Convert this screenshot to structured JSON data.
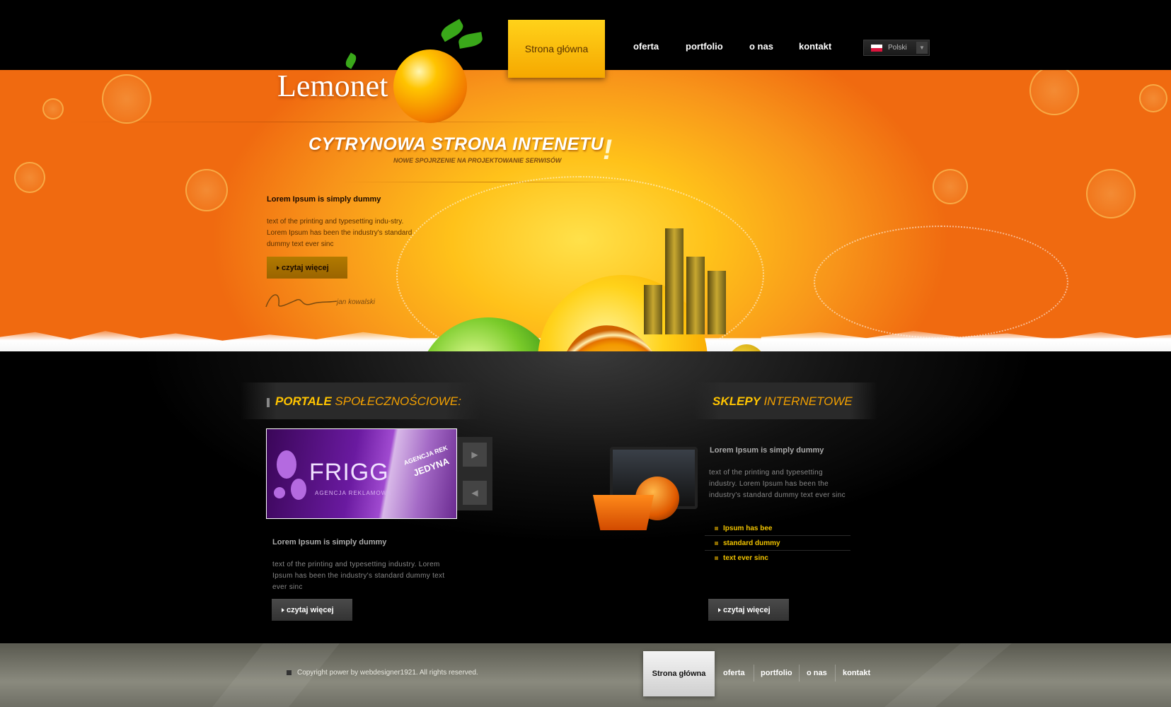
{
  "header": {
    "nav": [
      {
        "label": "Strona główna",
        "active": true
      },
      {
        "label": "oferta"
      },
      {
        "label": "portfolio"
      },
      {
        "label": "o nas"
      },
      {
        "label": "kontakt"
      }
    ],
    "language": {
      "label": "Polski",
      "flag": "flag-pl-icon"
    }
  },
  "logo": {
    "text": "Lemonet"
  },
  "hero": {
    "title": "CYTRYNOWA STRONA INTENETU",
    "subtitle": "NOWE SPOJRZENIE NA PROJEKTOWANIE SERWISÓW",
    "exclamation": "!",
    "heading": "Lorem Ipsum is simply dummy",
    "text": "text of the printing and typesetting indu-stry. Lorem Ipsum has been the industry's standard dummy text ever sinc",
    "button": "czytaj więcej",
    "signature_name": "jan kowalski"
  },
  "section_social": {
    "title_highlight": "PORTALE",
    "title_rest": "SPOŁECZNOŚCIOWE:",
    "slide": {
      "name": "FRIGG",
      "sub": "AGENCJA REKLAMOWA",
      "diag1": "AGENCJA REK",
      "diag2": "JEDYNA"
    },
    "heading": "Lorem Ipsum is simply dummy",
    "text": "text of the printing and typesetting industry. Lorem Ipsum has been the industry's standard dummy text ever sinc",
    "button": "czytaj więcej"
  },
  "section_shops": {
    "title_highlight": "SKLEPY",
    "title_rest": "INTERNETOWE",
    "heading": "Lorem Ipsum is simply dummy",
    "text": "text of the printing and typesetting industry. Lorem Ipsum has been the industry's standard dummy text ever sinc",
    "list": [
      "Ipsum has bee",
      "standard dummy",
      "text ever sinc"
    ],
    "button": "czytaj więcej"
  },
  "footer": {
    "copyright": "Copyright power by webdesigner1921. All rights reserved.",
    "nav": [
      {
        "label": "Strona główna",
        "active": true
      },
      {
        "label": "oferta"
      },
      {
        "label": "portfolio"
      },
      {
        "label": "o nas"
      },
      {
        "label": "kontakt"
      }
    ]
  },
  "colors": {
    "accent": "#ffc400",
    "orange": "#f2a000",
    "dark": "#000000"
  }
}
